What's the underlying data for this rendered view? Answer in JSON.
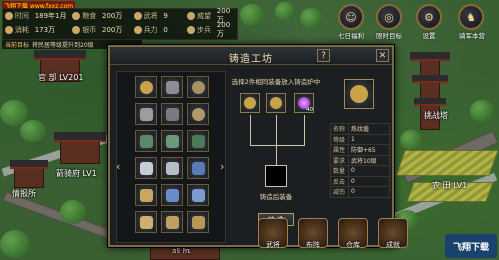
{
  "watermark": "飞翔下载 www.fxxz.com",
  "info_panel": {
    "row1": [
      {
        "label": "时间",
        "value": "189年1月"
      },
      {
        "label": "粮食",
        "value": "200万"
      },
      {
        "label": "武将",
        "value": "9"
      },
      {
        "label": "威望",
        "value": "200万"
      }
    ],
    "row2": [
      {
        "label": "消耗",
        "value": "173万"
      },
      {
        "label": "银币",
        "value": "200万"
      },
      {
        "label": "兵力",
        "value": "0"
      },
      {
        "label": "步兵",
        "value": "200万"
      }
    ],
    "target_label": "当前目标",
    "target_text": "将民居等级提升到20级"
  },
  "top_icons": [
    "七日福利",
    "限时目标",
    "设置",
    "骑军本营"
  ],
  "map_labels": {
    "office": "官 部 LV201",
    "academy": "箭骑府 LV1",
    "intel": "情报所",
    "challenge": "挑战塔",
    "farm": "农 田 LV1",
    "villa": "别 院"
  },
  "modal": {
    "title": "铸造工坊",
    "instruction": "选择2件相同装备放入铸造炉中",
    "result_label": "铸造后装备",
    "forge_button": "铸 造",
    "material_count": "40",
    "stats": [
      {
        "k": "名称",
        "v": "炼纹盾"
      },
      {
        "k": "等级",
        "v": "1"
      },
      {
        "k": "属性",
        "v": "防御+65"
      },
      {
        "k": "要求",
        "v": "武将10级"
      },
      {
        "k": "数量",
        "v": "0"
      },
      {
        "k": "反击",
        "v": "0"
      },
      {
        "k": "减伤",
        "v": "0"
      }
    ],
    "slots": [
      "shield",
      "helmet",
      "shield",
      "helmet",
      "helmet",
      "shield",
      "armor",
      "armor",
      "armor",
      "cloth",
      "cloth",
      "book",
      "scroll",
      "book",
      "book"
    ]
  },
  "bottom_bar": [
    "武将",
    "布阵",
    "仓库",
    "成就"
  ],
  "logo": "飞翔下载"
}
